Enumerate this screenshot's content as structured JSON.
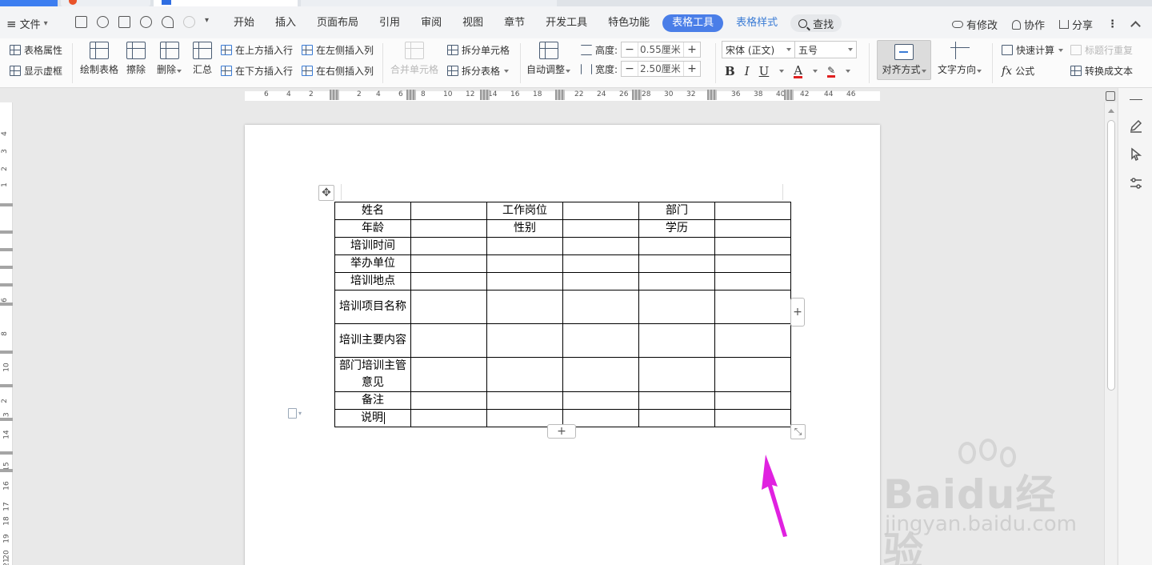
{
  "menubar": {
    "file_label": "文件",
    "tabs": [
      {
        "label": "开始"
      },
      {
        "label": "插入"
      },
      {
        "label": "页面布局"
      },
      {
        "label": "引用"
      },
      {
        "label": "审阅"
      },
      {
        "label": "视图"
      },
      {
        "label": "章节"
      },
      {
        "label": "开发工具"
      },
      {
        "label": "特色功能"
      },
      {
        "label": "表格工具"
      },
      {
        "label": "表格样式"
      }
    ],
    "search_label": "查找",
    "right": {
      "modified": "有修改",
      "collab": "协作",
      "share": "分享"
    }
  },
  "ribbon": {
    "table_props": "表格属性",
    "show_gridlines": "显示虚框",
    "draw_table": "绘制表格",
    "erase": "擦除",
    "delete": "删除",
    "summary": "汇总",
    "insert_above": "在上方插入行",
    "insert_below": "在下方插入行",
    "insert_left": "在左侧插入列",
    "insert_right": "在右侧插入列",
    "merge_cells": "合并单元格",
    "split_cells": "拆分单元格",
    "split_table": "拆分表格",
    "auto_fit": "自动调整",
    "height_label": "高度:",
    "height_value": "0.55厘米",
    "width_label": "宽度:",
    "width_value": "2.50厘米",
    "font_name": "宋体 (正文)",
    "font_size": "五号",
    "align_label": "对齐方式",
    "text_direction": "文字方向",
    "quick_calc": "快速计算",
    "repeat_header": "标题行重复",
    "formula": "公式",
    "convert_text": "转换成文本"
  },
  "ruler": {
    "h_ticks": [
      "6",
      "4",
      "2",
      "2",
      "4",
      "6",
      "8",
      "10",
      "12",
      "14",
      "16",
      "18",
      "22",
      "24",
      "26",
      "28",
      "30",
      "32",
      "36",
      "38",
      "40",
      "42",
      "44",
      "46"
    ],
    "v_ticks": [
      "4",
      "3",
      "2",
      "1",
      "6",
      "8",
      "10",
      "2",
      "13",
      "14",
      "15",
      "16",
      "17",
      "18",
      "19",
      "20",
      "21"
    ]
  },
  "document": {
    "table": [
      [
        "姓名",
        "",
        "工作岗位",
        "",
        "部门",
        ""
      ],
      [
        "年龄",
        "",
        "性别",
        "",
        "学历",
        ""
      ],
      [
        "培训时间",
        "",
        "",
        "",
        "",
        ""
      ],
      [
        "举办单位",
        "",
        "",
        "",
        "",
        ""
      ],
      [
        "培训地点",
        "",
        "",
        "",
        "",
        ""
      ],
      [
        "培训项目名称",
        "",
        "",
        "",
        "",
        ""
      ],
      [
        "培训主要内容",
        "",
        "",
        "",
        "",
        ""
      ],
      [
        "部门培训主管意见",
        "",
        "",
        "",
        "",
        ""
      ],
      [
        "备注",
        "",
        "",
        "",
        "",
        ""
      ],
      [
        "说明",
        "",
        "",
        "",
        "",
        ""
      ]
    ]
  },
  "watermark": {
    "brand": "Baidu经验",
    "url": "jingyan.baidu.com"
  },
  "colors": {
    "accent": "#4a7ee8",
    "arrow": "#e021e0",
    "font_color_bar": "#e02020"
  }
}
